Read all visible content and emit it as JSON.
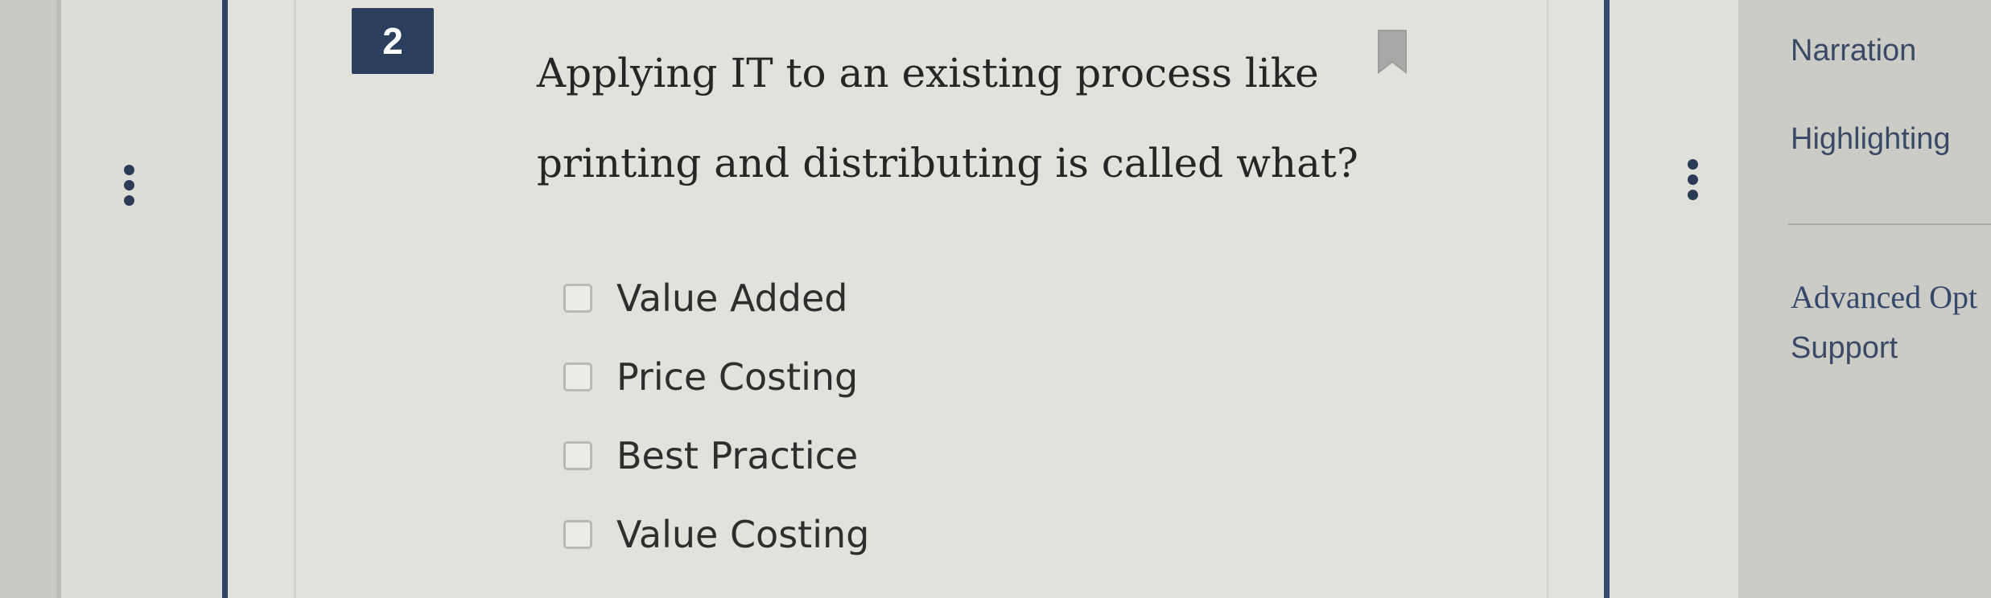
{
  "question": {
    "number": "2",
    "text": "Applying IT to an existing process like printing and distributing is called what?",
    "options": [
      {
        "label": "Value Added",
        "checked": false
      },
      {
        "label": "Price Costing",
        "checked": false
      },
      {
        "label": "Best Practice",
        "checked": false
      },
      {
        "label": "Value Costing",
        "checked": false
      }
    ]
  },
  "side_panel": {
    "narration": "Narration",
    "highlighting": "Highlighting",
    "advanced_options": "Advanced Opt",
    "support": "Support"
  },
  "colors": {
    "accent_navy": "#2c3e5d",
    "side_text": "#3a4a66"
  },
  "icons": {
    "bookmark": "bookmark-icon",
    "more_vertical": "more-vertical-icon"
  }
}
